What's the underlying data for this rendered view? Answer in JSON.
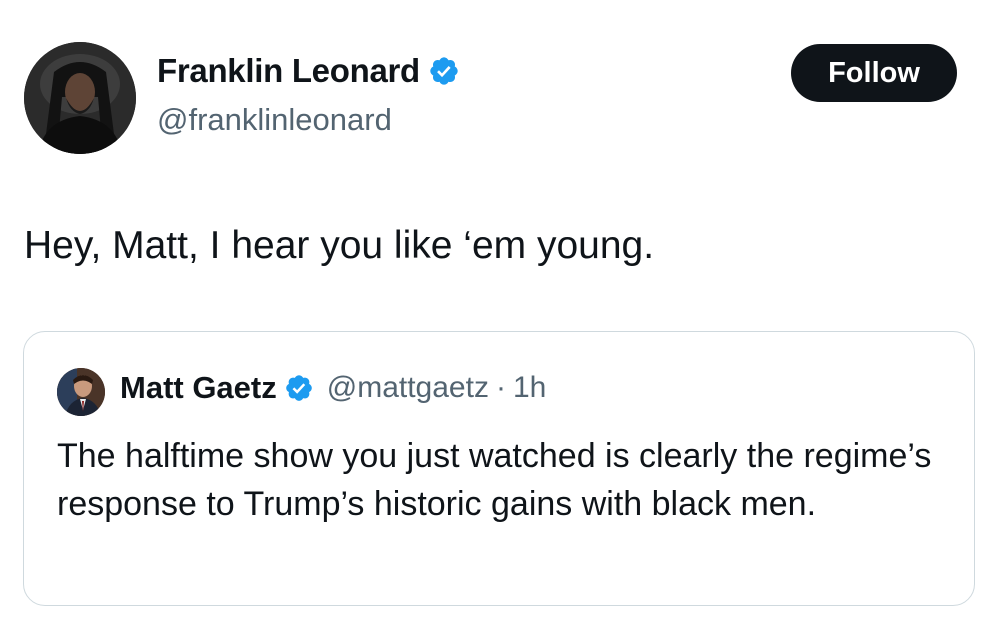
{
  "author": {
    "name": "Franklin Leonard",
    "handle": "@franklinleonard",
    "verified": true
  },
  "follow_button": {
    "label": "Follow"
  },
  "tweet": {
    "text": "Hey, Matt, I hear you like ‘em young."
  },
  "quoted_tweet": {
    "author_name": "Matt Gaetz",
    "handle": "@mattgaetz",
    "separator": "·",
    "time": "1h",
    "verified": true,
    "text": "The halftime show you just watched is clearly the regime’s response to Trump’s historic gains with black men."
  },
  "colors": {
    "verified_badge": "#1d9bf0",
    "follow_button_bg": "#0f1419",
    "secondary_text": "#536471",
    "card_border": "#cfd9de"
  },
  "icons": {
    "verified": "verified-badge-icon"
  }
}
